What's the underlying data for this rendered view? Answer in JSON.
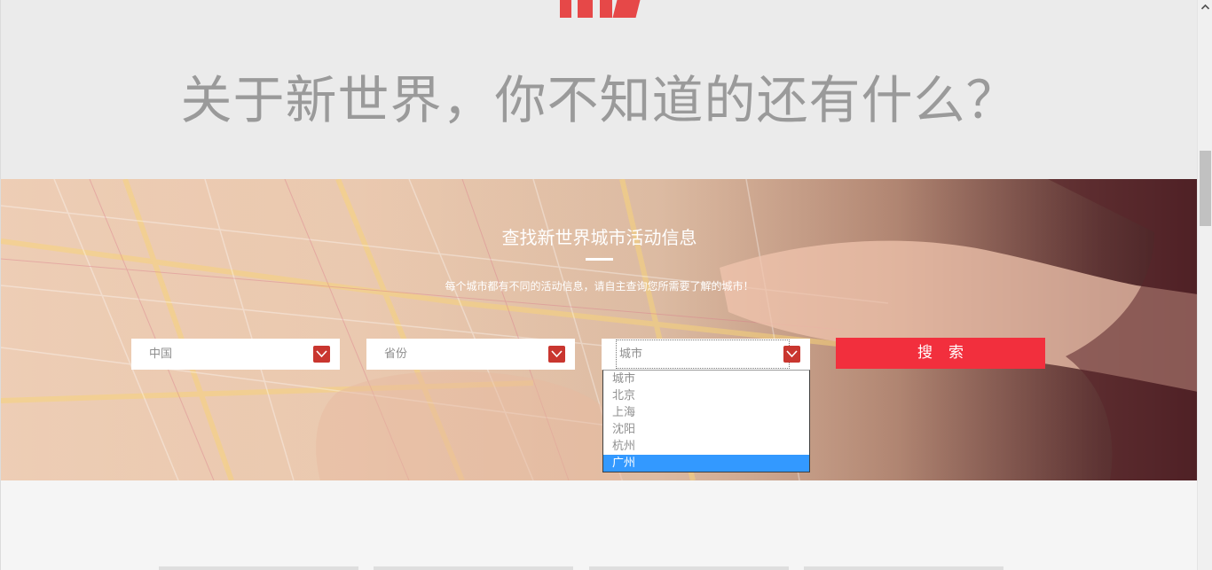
{
  "headline": "关于新世界，你不知道的还有什么？",
  "hero": {
    "title": "查找新世界城市活动信息",
    "subtitle": "每个城市都有不同的活动信息，请自主查询您所需要了解的城市！"
  },
  "filters": {
    "country_value": "中国",
    "province_value": "省份",
    "city_value": "城市",
    "search_label": "搜索"
  },
  "city_dropdown": {
    "options": [
      "城市",
      "北京",
      "上海",
      "沈阳",
      "杭州",
      "广州"
    ],
    "highlighted": "广州"
  },
  "colors": {
    "brand_red": "#f22f3d",
    "arrow_red": "#c9362f",
    "highlight_blue": "#3399ff",
    "headline_gray": "#9a9a9a"
  },
  "icons": [
    "chevron-down-icon",
    "scroll-up-arrow-icon"
  ]
}
